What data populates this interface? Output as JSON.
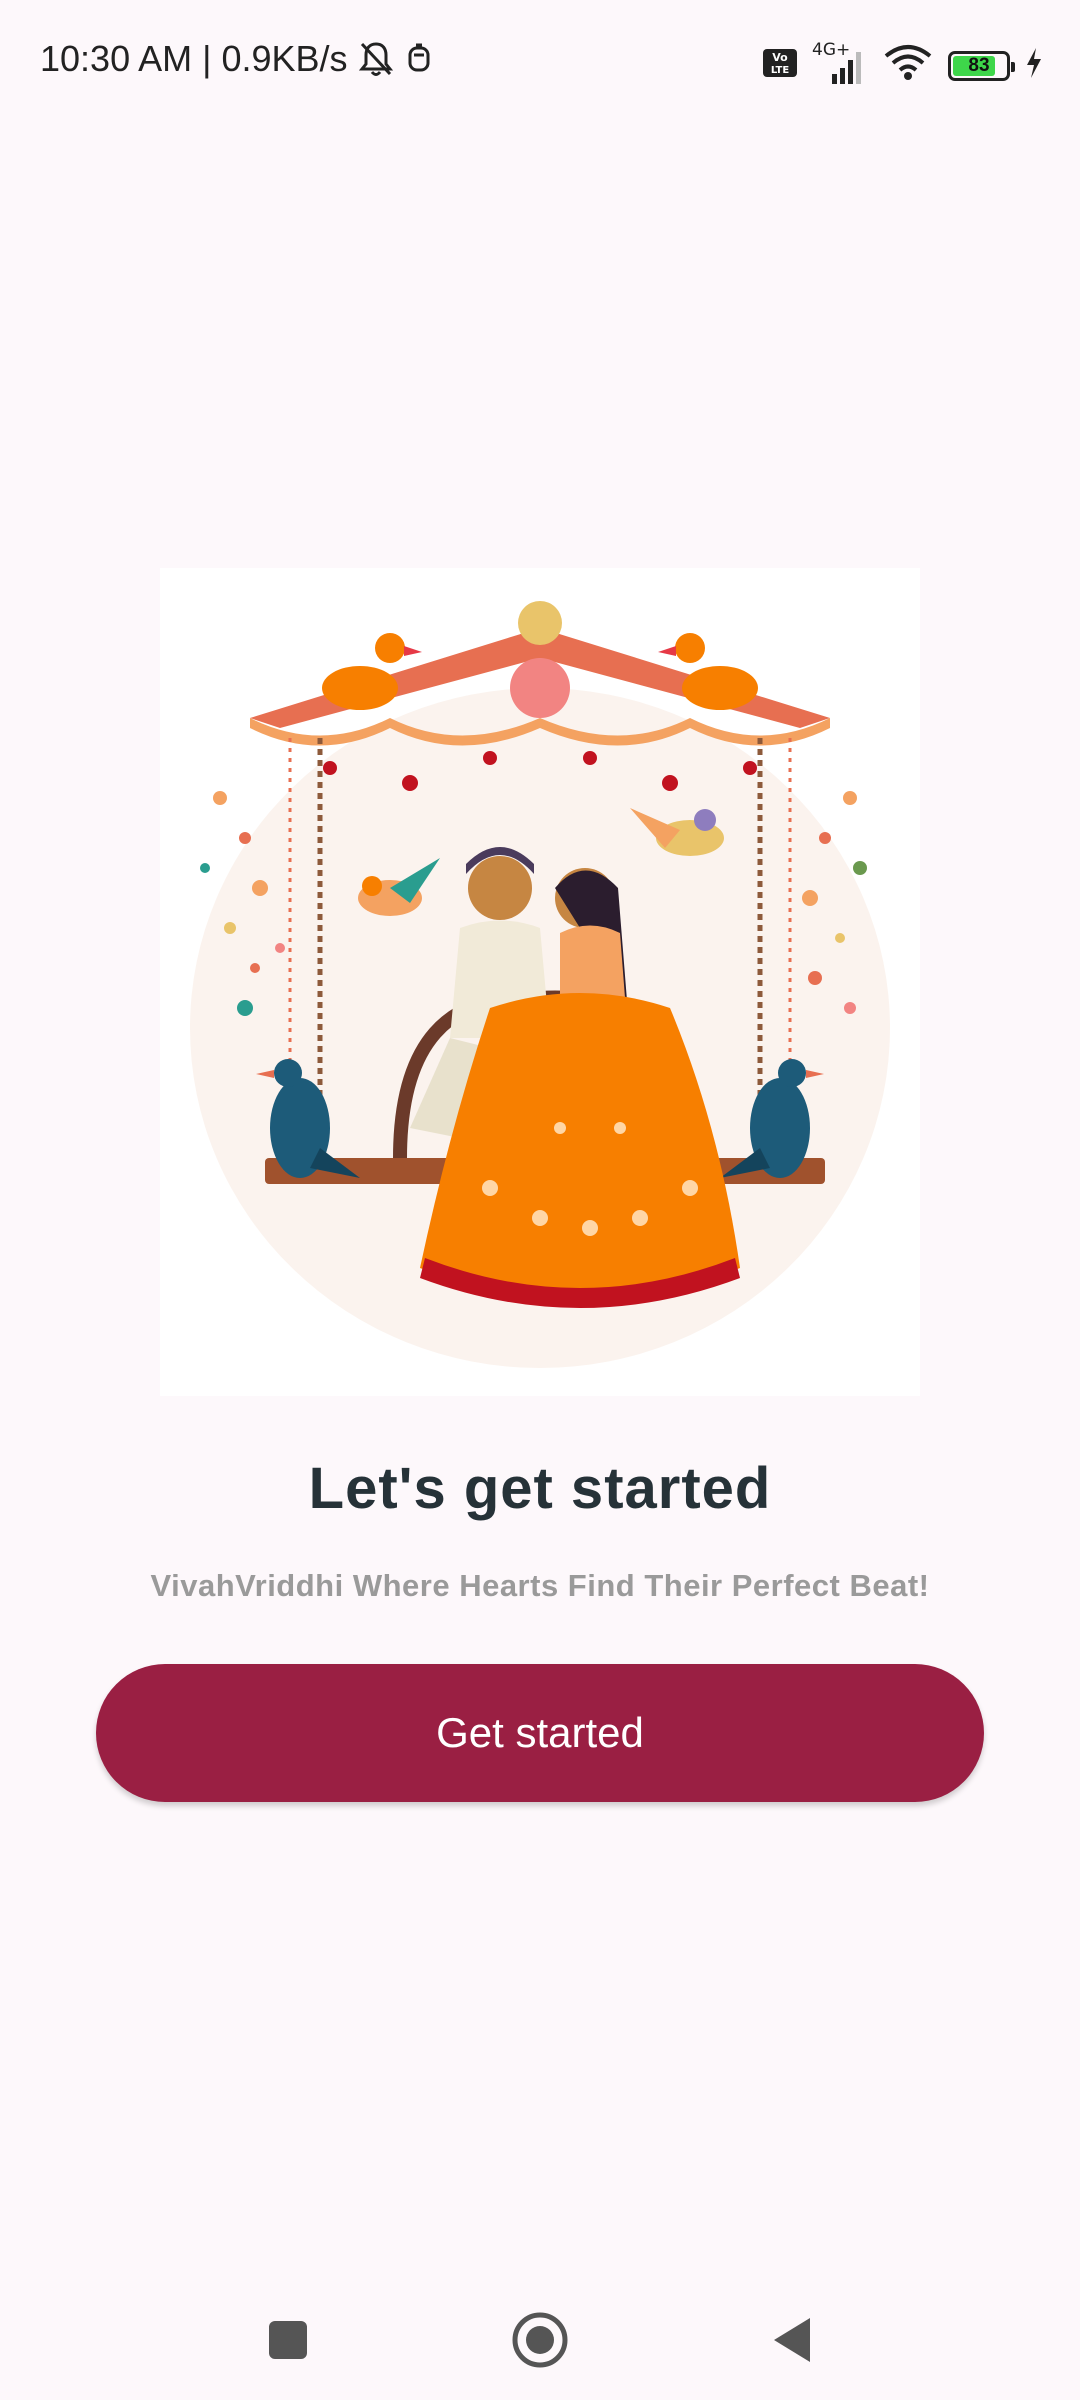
{
  "status_bar": {
    "time_speed": "10:30 AM | 0.9KB/s",
    "network_label": "4G+",
    "volte_label": "Vo LTE",
    "battery_level": "83",
    "battery_fraction": 0.83,
    "icons": [
      "bell-off-icon",
      "notification-app-icon",
      "volte-icon",
      "signal-icon",
      "wifi-icon",
      "battery-icon",
      "charging-icon"
    ]
  },
  "hero": {
    "illustration": "couple-on-swing-illustration"
  },
  "content": {
    "headline": "Let's get started",
    "tagline": "VivahVriddhi Where Hearts Find Their Perfect Beat!"
  },
  "actions": {
    "get_started_label": "Get started"
  },
  "nav": {
    "icons": [
      "recents-icon",
      "home-icon",
      "back-icon"
    ]
  },
  "colors": {
    "background": "#fdf8fb",
    "primary_button": "#9a1f43",
    "headline_text": "#263238",
    "tagline_text": "#9a9a9a",
    "battery_fill": "#3ed64a"
  }
}
